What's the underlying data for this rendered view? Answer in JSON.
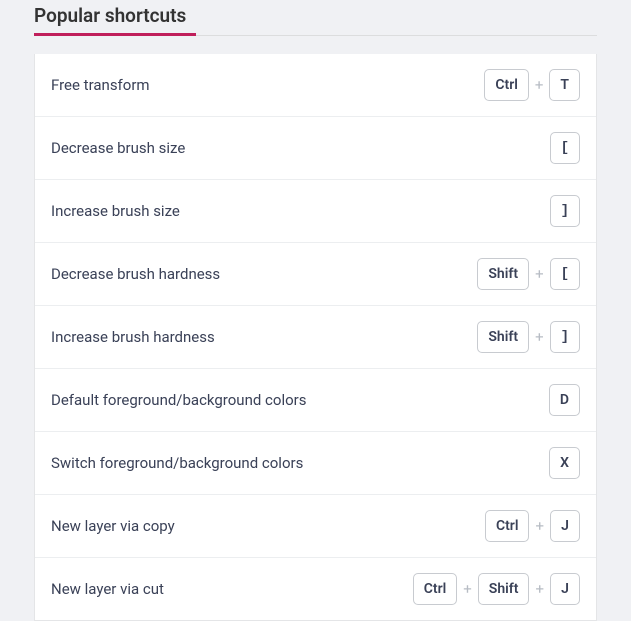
{
  "section_title": "Popular shortcuts",
  "plus": "+",
  "shortcuts": [
    {
      "label": "Free transform",
      "keys": [
        "Ctrl",
        "T"
      ]
    },
    {
      "label": "Decrease brush size",
      "keys": [
        "["
      ]
    },
    {
      "label": "Increase brush size",
      "keys": [
        "]"
      ]
    },
    {
      "label": "Decrease brush hardness",
      "keys": [
        "Shift",
        "["
      ]
    },
    {
      "label": "Increase brush hardness",
      "keys": [
        "Shift",
        "]"
      ]
    },
    {
      "label": "Default foreground/background colors",
      "keys": [
        "D"
      ]
    },
    {
      "label": "Switch foreground/background colors",
      "keys": [
        "X"
      ]
    },
    {
      "label": "New layer via copy",
      "keys": [
        "Ctrl",
        "J"
      ]
    },
    {
      "label": "New layer via cut",
      "keys": [
        "Ctrl",
        "Shift",
        "J"
      ]
    }
  ]
}
